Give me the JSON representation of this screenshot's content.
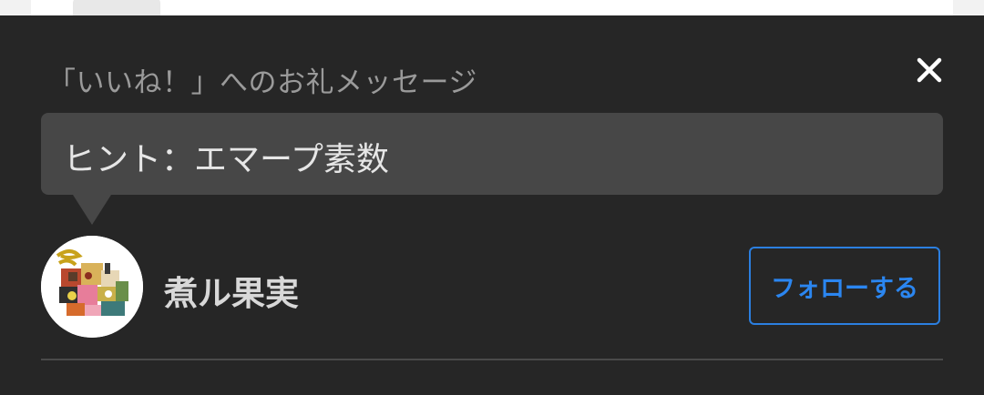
{
  "dialog": {
    "title": "「いいね！」へのお礼メッセージ",
    "close_icon": "close-icon"
  },
  "message": {
    "text": "ヒント：エマープ素数"
  },
  "user": {
    "name": "煮ル果実",
    "avatar_icon": "avatar"
  },
  "follow": {
    "label": "フォローする"
  },
  "colors": {
    "sheet_bg": "#262626",
    "bubble_bg": "#474747",
    "accent": "#2b86f0",
    "title_text": "#9a9a9a"
  }
}
